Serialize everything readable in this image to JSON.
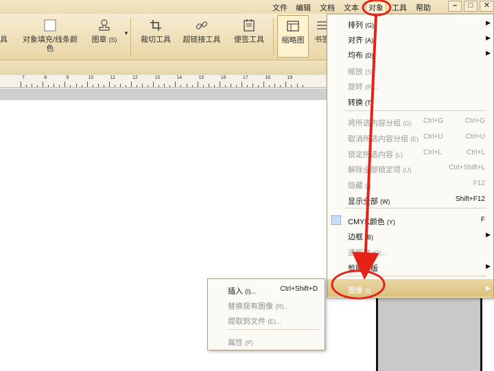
{
  "menubar": {
    "items": [
      "文件",
      "编辑",
      "文档",
      "文本",
      "对象",
      "工具",
      "帮助"
    ],
    "active_index": 4,
    "window_buttons": [
      "–",
      "□",
      "✕"
    ]
  },
  "toolbar": {
    "tool_partial": "具",
    "fill_stroke_label_1": "对象填充/线条颜",
    "fill_stroke_label_2": "色",
    "stamp_label": "图章",
    "stamp_key": "(S)",
    "crop_label": "裁切工具",
    "link_label": "超链接工具",
    "note_label": "便签工具",
    "thumb_label": "缩略图",
    "bookmark_partial": "书签"
  },
  "ruler": {
    "labels": [
      "7",
      "8",
      "9",
      "10",
      "11",
      "12",
      "13",
      "14",
      "15",
      "16",
      "17",
      "18",
      "19"
    ]
  },
  "context_menu": {
    "items": [
      {
        "label": "排列",
        "key": "(G)",
        "state": "enabled",
        "submenu": true
      },
      {
        "label": "对齐",
        "key": "(A)",
        "state": "enabled",
        "submenu": true
      },
      {
        "label": "均布",
        "key": "(D)",
        "state": "enabled",
        "submenu": true
      },
      {
        "label": "缩放",
        "key": "(S)",
        "state": "disabled"
      },
      {
        "label": "旋转",
        "key": "(R)...",
        "state": "disabled"
      },
      {
        "label": "转换",
        "key": "(T)",
        "state": "enabled"
      },
      {
        "label": "将所选内容分组",
        "key": "(G)",
        "shortcut1": "Ctrl+G",
        "shortcut2": "Ctrl+G",
        "state": "disabled"
      },
      {
        "label": "取消所选内容分组",
        "key": "(E)",
        "shortcut1": "Ctrl+U",
        "shortcut2": "Ctrl+U",
        "state": "disabled"
      },
      {
        "label": "锁定所选内容",
        "key": "(L)",
        "shortcut1": "Ctrl+L",
        "shortcut2": "Ctrl+L",
        "state": "disabled"
      },
      {
        "label": "解除全部锁定项",
        "key": "(U)",
        "shortcut2": "Ctrl+Shift+L",
        "state": "disabled"
      },
      {
        "label": "隐藏",
        "key": "(I)",
        "shortcut2": "F12",
        "state": "disabled"
      },
      {
        "label": "显示全部",
        "key": "(W)",
        "shortcut2": "Shift+F12",
        "state": "enabled"
      },
      {
        "label": "CMYK颜色",
        "key": "(Y)",
        "shortcut2": "F",
        "state": "enabled"
      },
      {
        "label": "边框",
        "key": "(B)",
        "state": "enabled",
        "submenu": true
      },
      {
        "label": "透明度",
        "key": "(O)...",
        "state": "disabled"
      },
      {
        "label": "剪贴蒙版",
        "key": "",
        "state": "enabled",
        "submenu": true
      },
      {
        "label": "图像",
        "key": "(I)",
        "state": "highlight",
        "submenu": true
      }
    ]
  },
  "image_submenu": {
    "items": [
      {
        "label": "插入",
        "key": "(I)...",
        "shortcut": "Ctrl+Shift+D",
        "state": "enabled"
      },
      {
        "label": "替换现有图像",
        "key": "(R)...",
        "state": "disabled"
      },
      {
        "label": "提取到文件",
        "key": "(E)...",
        "state": "disabled"
      },
      {
        "label": "属性",
        "key": "(P)",
        "state": "disabled"
      }
    ]
  },
  "colors": {
    "annotation_red": "#e32219",
    "ribbon": "#ead7a6",
    "highlight": "#dcc07c"
  }
}
